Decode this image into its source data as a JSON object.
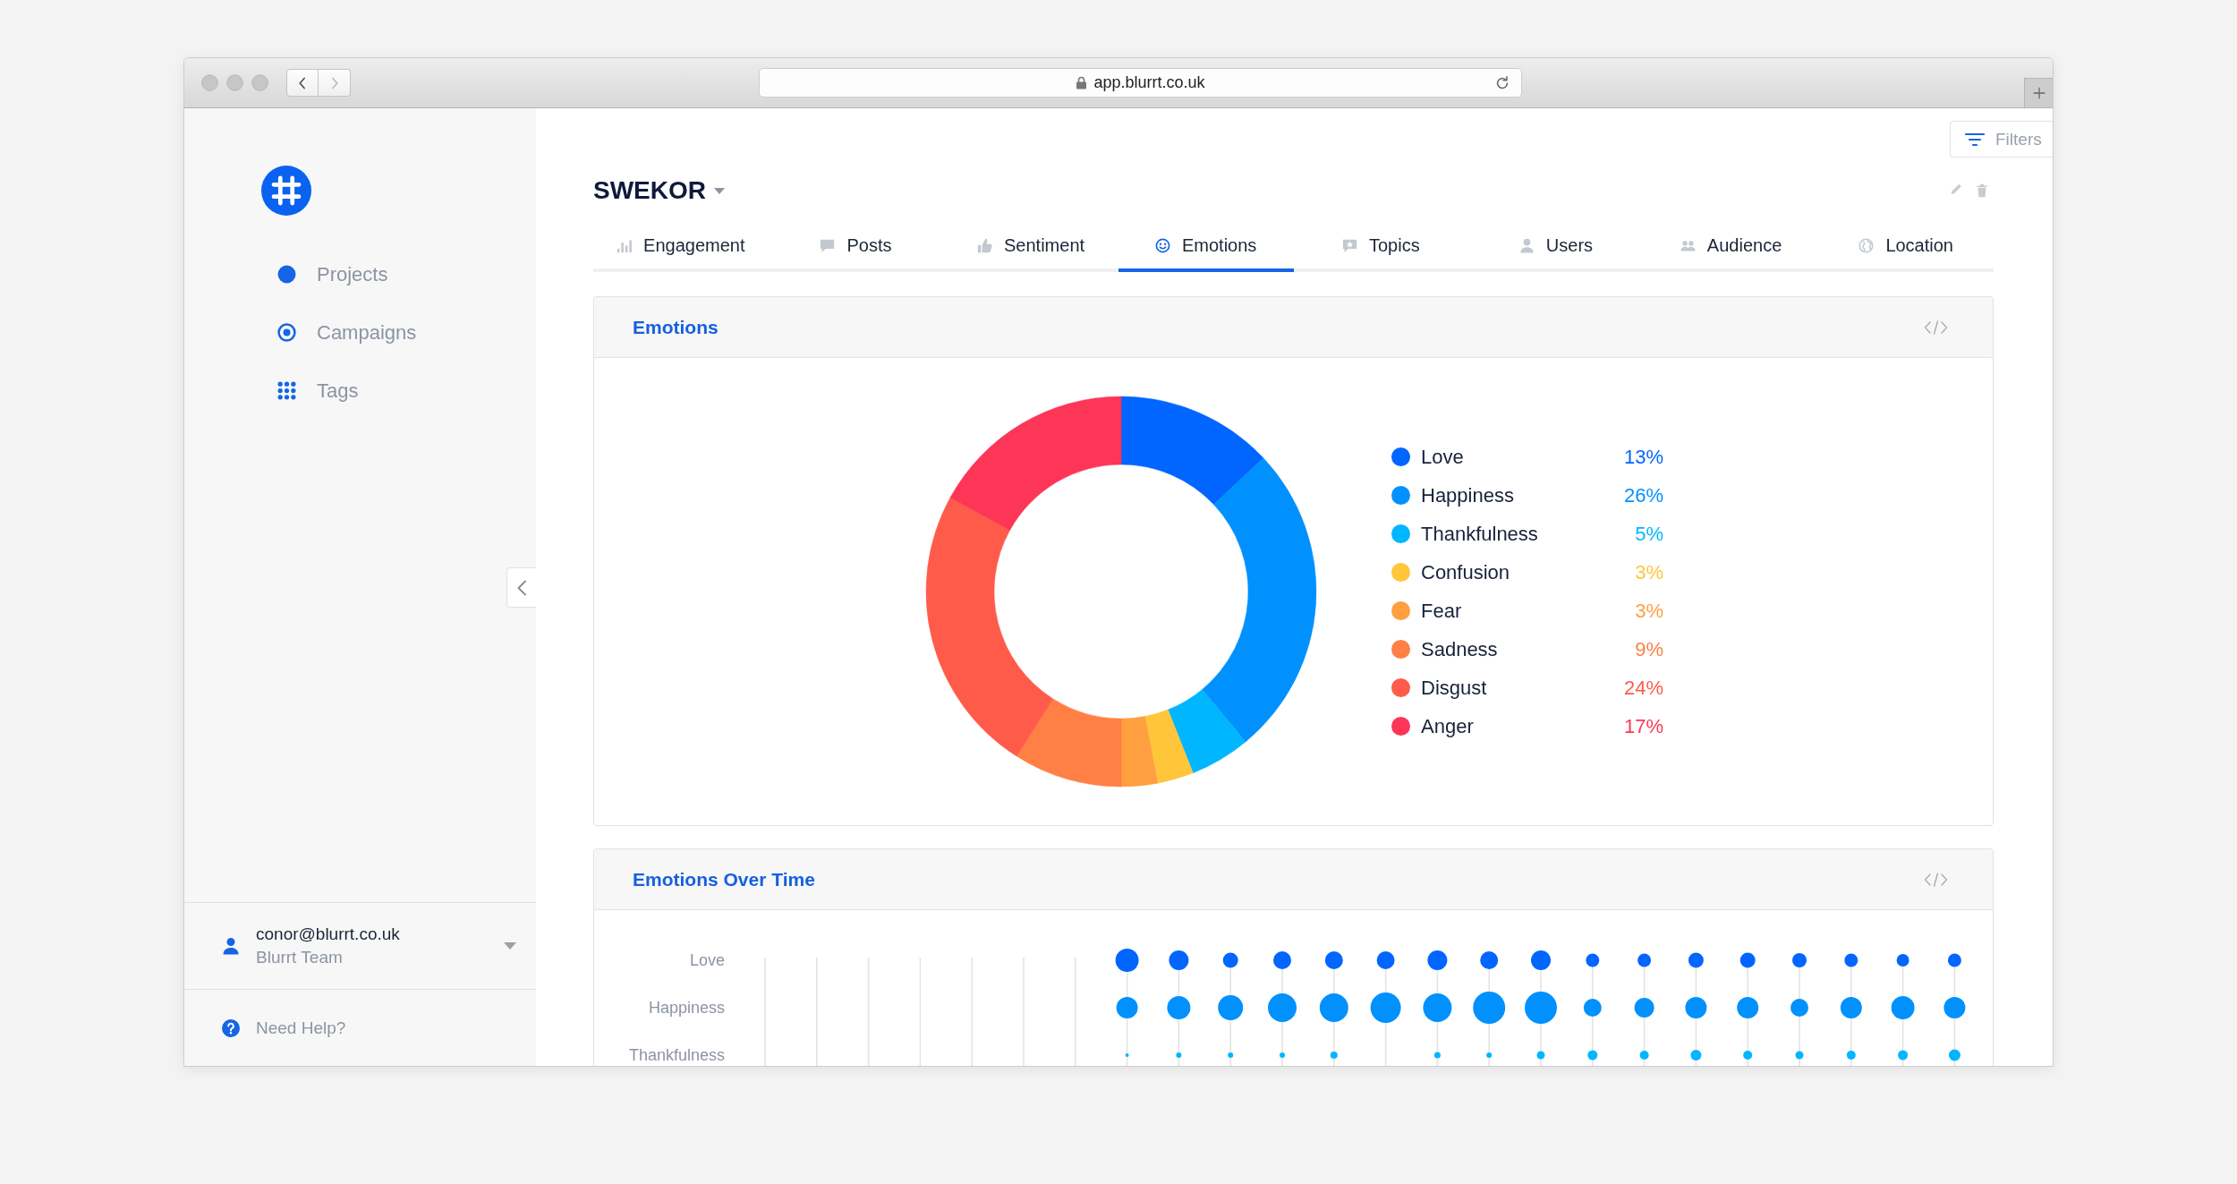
{
  "browser": {
    "url": "app.blurrt.co.uk",
    "back": {
      "disabled": false
    },
    "forward": {
      "disabled": true
    }
  },
  "sidebar": {
    "items": [
      {
        "label": "Projects"
      },
      {
        "label": "Campaigns"
      },
      {
        "label": "Tags"
      }
    ],
    "user": {
      "email": "conor@blurrt.co.uk",
      "team": "Blurrt Team"
    },
    "help_link": "Need Help?"
  },
  "filters_button": {
    "label": "Filters"
  },
  "project": {
    "title": "SWEKOR"
  },
  "tabs": [
    {
      "label": "Engagement",
      "selected": false
    },
    {
      "label": "Posts",
      "selected": false
    },
    {
      "label": "Sentiment",
      "selected": false
    },
    {
      "label": "Emotions",
      "selected": true
    },
    {
      "label": "Topics",
      "selected": false
    },
    {
      "label": "Users",
      "selected": false
    },
    {
      "label": "Audience",
      "selected": false
    },
    {
      "label": "Location",
      "selected": false
    }
  ],
  "emotions_panel": {
    "title": "Emotions",
    "chart_data": {
      "type": "donut",
      "categories": [
        "Love",
        "Happiness",
        "Thankfulness",
        "Confusion",
        "Fear",
        "Sadness",
        "Disgust",
        "Anger"
      ],
      "values": [
        13,
        26,
        5,
        3,
        3,
        9,
        24,
        17
      ]
    },
    "legend": [
      {
        "color": "#0066ff",
        "percent": "13%"
      },
      {
        "color": "#0091ff",
        "percent": "26%"
      },
      {
        "color": "#00b6ff",
        "percent": "5%"
      },
      {
        "color": "#ffc63b",
        "percent": "3%"
      },
      {
        "color": "#ff9f3f",
        "percent": "3%"
      },
      {
        "color": "#ff7f44",
        "percent": "9%"
      },
      {
        "color": "#ff5b4b",
        "percent": "24%"
      },
      {
        "color": "#fd3556",
        "percent": "17%"
      }
    ]
  },
  "over_time_panel": {
    "title": "Emotions Over Time",
    "rows": [
      {
        "label": "Love",
        "color": "#0066ff"
      },
      {
        "label": "Happiness",
        "color": "#0091ff"
      },
      {
        "label": "Thankfulness",
        "color": "#00b6ff"
      }
    ]
  }
}
